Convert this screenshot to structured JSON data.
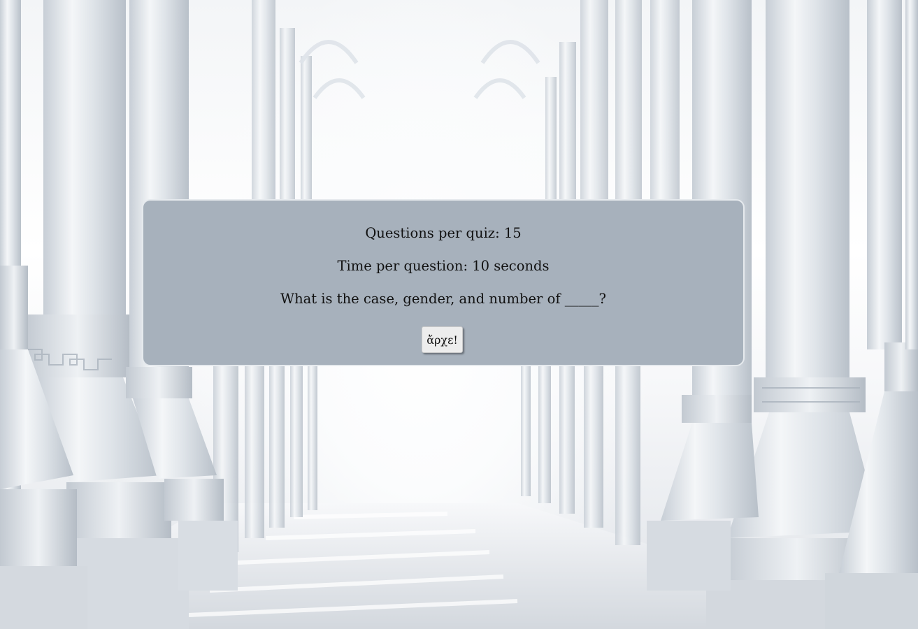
{
  "quiz_settings": {
    "questions_label": "Questions per quiz:",
    "questions_value": "15",
    "time_label": "Time per question:",
    "time_value": "10",
    "time_unit": "seconds",
    "prompt": "What is the case, gender, and number of _____?"
  },
  "start_button": {
    "label": "ἄρχε!"
  },
  "colors": {
    "panel_background": "#a7b1bc",
    "panel_border": "#e6eaee",
    "button_background": "#ededed",
    "text": "#111111"
  }
}
